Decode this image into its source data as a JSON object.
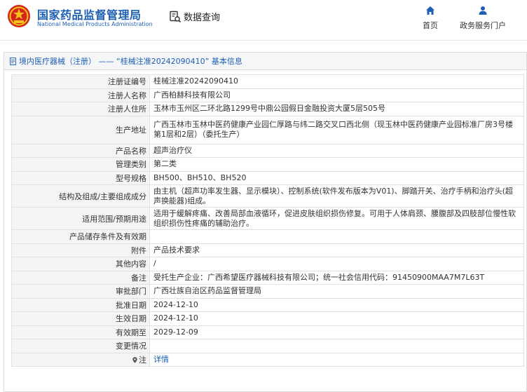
{
  "header": {
    "brand_cn": "国家药品监督管理局",
    "brand_en": "National Medical Products Administration",
    "query_label": "数据查询",
    "nav": [
      {
        "label": "首页",
        "icon": "home-icon"
      },
      {
        "label": "政务服务门户",
        "icon": "user-icon"
      }
    ]
  },
  "panel": {
    "title": "境内医疗器械（注册） ——  “桂械注准20242090410”  基本信息"
  },
  "rows": [
    {
      "label": "注册证编号",
      "value": "桂械注准20242090410"
    },
    {
      "label": "注册人名称",
      "value": "广西柏赫科技有限公司"
    },
    {
      "label": "注册人住所",
      "value": "玉林市玉州区二环北路1299号中鼎公园假日金融投资大厦5层505号"
    },
    {
      "label": "生产地址",
      "value": "广西玉林市玉林中医药健康产业园仁厚路与纬二路交叉口西北侧（现玉林中医药健康产业园标准厂房3号楼第1层和2层）（委托生产）"
    },
    {
      "label": "产品名称",
      "value": "超声治疗仪"
    },
    {
      "label": "管理类别",
      "value": "第二类"
    },
    {
      "label": "型号规格",
      "value": "BH500、BH510、BH520"
    },
    {
      "label": "结构及组成/主要组成成分",
      "value": "由主机（超声功率发生器、显示模块）、控制系统(软件发布版本为V01)、脚踏开关、治疗手柄和治疗头(超声换能器)组成。"
    },
    {
      "label": "适用范围/预期用途",
      "value": "适用于缓解疼痛、改善局部血液循环，促进皮肤组织损伤修复。可用于人体肩颈、腰腹部及四肢部位慢性软组织损伤性疼痛的辅助治疗。"
    },
    {
      "label": "产品储存条件及有效期",
      "value": ""
    },
    {
      "label": "附件",
      "value": "产品技术要求"
    },
    {
      "label": "其他内容",
      "value": "/"
    },
    {
      "label": "备注",
      "value": "受托生产企业：广西希望医疗器械科技有限公司；统一社会信用代码：91450900MAA7M7L63T"
    },
    {
      "label": "审批部门",
      "value": "广西壮族自治区药品监督管理局"
    },
    {
      "label": "批准日期",
      "value": "2024-12-10"
    },
    {
      "label": "生效日期",
      "value": "2024-12-10"
    },
    {
      "label": "有效期至",
      "value": "2029-12-09"
    },
    {
      "label": "变更情况",
      "value": ""
    }
  ],
  "note": {
    "label": "注",
    "link": "详情"
  },
  "colors": {
    "brand_blue": "#1d5fb4",
    "label_bg": "#f4f4f4",
    "border": "#e2e2e2"
  }
}
